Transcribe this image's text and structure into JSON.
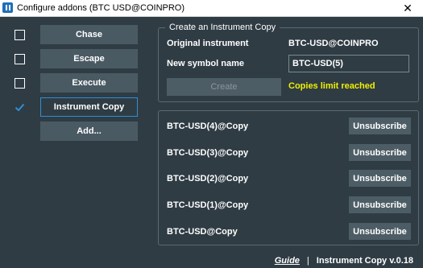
{
  "window": {
    "title": "Configure addons (BTC USD@COINPRO)",
    "close_glyph": "✕"
  },
  "sidebar": {
    "items": [
      {
        "label": "Chase",
        "checked": false
      },
      {
        "label": "Escape",
        "checked": false
      },
      {
        "label": "Execute",
        "checked": false
      },
      {
        "label": "Instrument Copy",
        "checked": true
      }
    ],
    "add_label": "Add..."
  },
  "create_panel": {
    "legend": "Create an Instrument Copy",
    "original_label": "Original instrument",
    "original_value": "BTC-USD@COINPRO",
    "symbol_label": "New symbol name",
    "symbol_value": "BTC-USD(5)",
    "create_label": "Create",
    "limit_message": "Copies limit reached"
  },
  "copies": {
    "unsubscribe_label": "Unsubscribe",
    "items": [
      {
        "name": "BTC-USD(4)@Copy"
      },
      {
        "name": "BTC-USD(3)@Copy"
      },
      {
        "name": "BTC-USD(2)@Copy"
      },
      {
        "name": "BTC-USD(1)@Copy"
      },
      {
        "name": "BTC-USD@Copy"
      }
    ]
  },
  "footer": {
    "guide_label": "Guide",
    "separator": "|",
    "version": "Instrument Copy v.0.18"
  },
  "colors": {
    "background": "#2f3c44",
    "button": "#4a5a63",
    "accent_blue": "#2e8fd6",
    "warning_yellow": "#f0f000"
  }
}
